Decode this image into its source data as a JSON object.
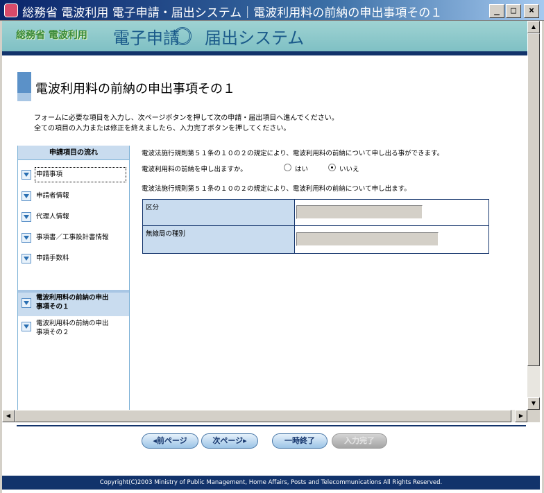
{
  "window": {
    "title": "総務省 電波利用 電子申請・届出システム｜電波利用料の前納の申出事項その１",
    "min_label": "_",
    "max_label": "□",
    "close_label": "×"
  },
  "banner": {
    "left_text": "総務省 電波利用",
    "right_text_a": "電子申請",
    "right_text_b": "届出システム"
  },
  "page": {
    "title": "電波利用料の前納の申出事項その１",
    "instruction_1": "フォームに必要な項目を入力し、次ページボタンを押して次の申請・届出項目へ進んでください。",
    "instruction_2": "全ての項目の入力または修正を終えましたら、入力完了ボタンを押してください。"
  },
  "sidebar": {
    "heading": "申請項目の流れ",
    "items": [
      {
        "label": "申請事項"
      },
      {
        "label": "申請者情報"
      },
      {
        "label": "代理人情報"
      },
      {
        "label": "事項書／工事設計書情報"
      },
      {
        "label": "申請手数料"
      },
      {
        "label_1": "電波利用料の前納の申出",
        "label_2": "事項その１"
      },
      {
        "label_1": "電波利用料の前納の申出",
        "label_2": "事項その２"
      }
    ]
  },
  "main": {
    "rule_text_1": "電波法施行規則第５１条の１０の２の規定により、電波利用料の前納について申し出る事ができます。",
    "question": "電波利用料の前納を申し出ますか。",
    "option_yes": "はい",
    "option_no": "いいえ",
    "selected": "いいえ",
    "rule_text_2": "電波法施行規則第５１条の１０の２の規定により、電波利用料の前納について申し出ます。",
    "rows": [
      {
        "label": "区分",
        "value": ""
      },
      {
        "label": "無線局の種別",
        "value": ""
      }
    ]
  },
  "nav": {
    "prev": "◂前ページ",
    "next": "次ページ▸",
    "pause": "一時終了",
    "complete": "入力完了"
  },
  "footer": {
    "copyright": "Copyright(C)2003 Ministry of Public Management, Home Affairs, Posts and Telecommunications All Rights Reserved."
  },
  "colors": {
    "navy": "#12336b",
    "banner_teal": "#8ccbcc",
    "label_blue": "#c9dcef",
    "accent_blue": "#5b91c8"
  }
}
